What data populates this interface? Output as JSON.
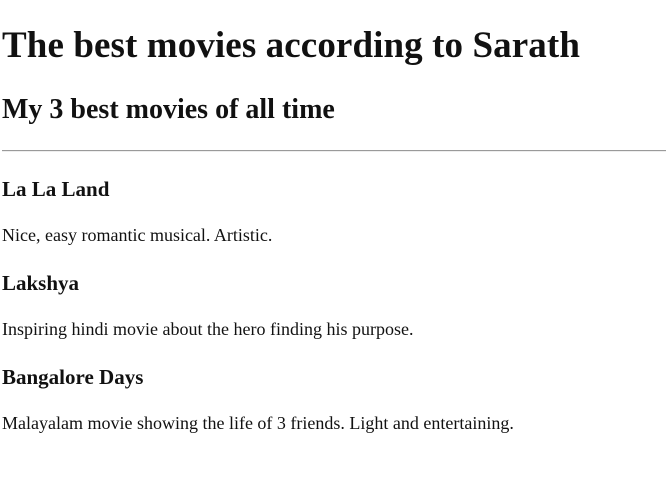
{
  "page": {
    "title": "The best movies according to Sarath",
    "subtitle": "My 3 best movies of all time"
  },
  "movies": [
    {
      "title": "La La Land",
      "description": "Nice, easy romantic musical. Artistic."
    },
    {
      "title": "Lakshya",
      "description": "Inspiring hindi movie about the hero finding his purpose."
    },
    {
      "title": "Bangalore Days",
      "description": "Malayalam movie showing the life of 3 friends. Light and entertaining."
    }
  ]
}
